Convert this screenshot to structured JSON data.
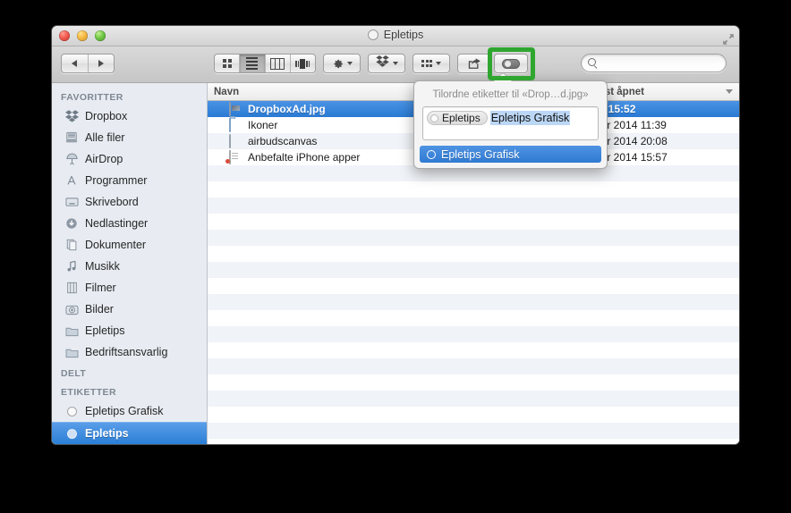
{
  "window": {
    "title": "Epletips",
    "title_icon": "tag-circle-icon",
    "traffic_lights": [
      "close-button",
      "minimize-button",
      "zoom-button"
    ],
    "fullscreen_icon": "fullscreen-arrows-icon"
  },
  "toolbar": {
    "back_icon": "chevron-left-icon",
    "forward_icon": "chevron-right-icon",
    "view_modes": [
      {
        "name": "icon-view",
        "icon": "grid-icon",
        "active": false
      },
      {
        "name": "list-view",
        "icon": "list-icon",
        "active": true
      },
      {
        "name": "column-view",
        "icon": "columns-icon",
        "active": false
      },
      {
        "name": "coverflow-view",
        "icon": "coverflow-icon",
        "active": false
      }
    ],
    "action_icon": "gear-icon",
    "dropbox_icon": "dropbox-icon",
    "arrange_icon": "arrange-grid-icon",
    "share_icon": "share-arrow-icon",
    "tag_icon": "tag-pill-icon"
  },
  "search": {
    "icon": "search-icon",
    "value": "",
    "placeholder": ""
  },
  "annotation": {
    "color": "#2fa62f",
    "target": "tag-toolbar-button"
  },
  "sidebar": {
    "sections": [
      {
        "header": "FAVORITTER",
        "items": [
          {
            "label": "Dropbox",
            "icon": "dropbox-icon",
            "selected": false
          },
          {
            "label": "Alle filer",
            "icon": "all-files-icon",
            "selected": false
          },
          {
            "label": "AirDrop",
            "icon": "airdrop-icon",
            "selected": false
          },
          {
            "label": "Programmer",
            "icon": "applications-icon",
            "selected": false
          },
          {
            "label": "Skrivebord",
            "icon": "desktop-icon",
            "selected": false
          },
          {
            "label": "Nedlastinger",
            "icon": "downloads-icon",
            "selected": false
          },
          {
            "label": "Dokumenter",
            "icon": "documents-icon",
            "selected": false
          },
          {
            "label": "Musikk",
            "icon": "music-icon",
            "selected": false
          },
          {
            "label": "Filmer",
            "icon": "movies-icon",
            "selected": false
          },
          {
            "label": "Bilder",
            "icon": "pictures-icon",
            "selected": false
          },
          {
            "label": "Epletips",
            "icon": "folder-icon",
            "selected": false
          },
          {
            "label": "Bedriftsansvarlig",
            "icon": "folder-icon",
            "selected": false
          }
        ]
      },
      {
        "header": "DELT",
        "items": []
      },
      {
        "header": "ETIKETTER",
        "items": [
          {
            "label": "Epletips Grafisk",
            "icon": "tag-circle-icon",
            "selected": false
          },
          {
            "label": "Epletips",
            "icon": "tag-circle-icon",
            "selected": true
          }
        ]
      }
    ]
  },
  "filelist": {
    "columns": [
      "Navn",
      "Sist åpnet"
    ],
    "sort_icon": "sort-descending-icon",
    "rows": [
      {
        "name": "DropboxAd.jpg",
        "icon": "image-file-icon",
        "date": "rs 15:52",
        "selected": true
      },
      {
        "name": "Ikoner",
        "icon": "folder-icon",
        "date": "uar 2014 11:39",
        "selected": false
      },
      {
        "name": "airbudscanvas",
        "icon": "canvas-file-icon",
        "date": "uar 2014 20:08",
        "selected": false
      },
      {
        "name": "Anbefalte iPhone apper",
        "icon": "document-file-icon",
        "date": "uar 2014 15:57",
        "selected": false
      }
    ],
    "empty_row_count": 17
  },
  "popover": {
    "title": "Tilordne etiketter til «Drop…d.jpg»",
    "token": {
      "label": "Epletips",
      "icon": "tag-circle-icon"
    },
    "input_text": "Epletips Grafisk",
    "menu": [
      {
        "label": "Epletips Grafisk",
        "icon": "tag-circle-icon",
        "selected": true
      }
    ]
  }
}
